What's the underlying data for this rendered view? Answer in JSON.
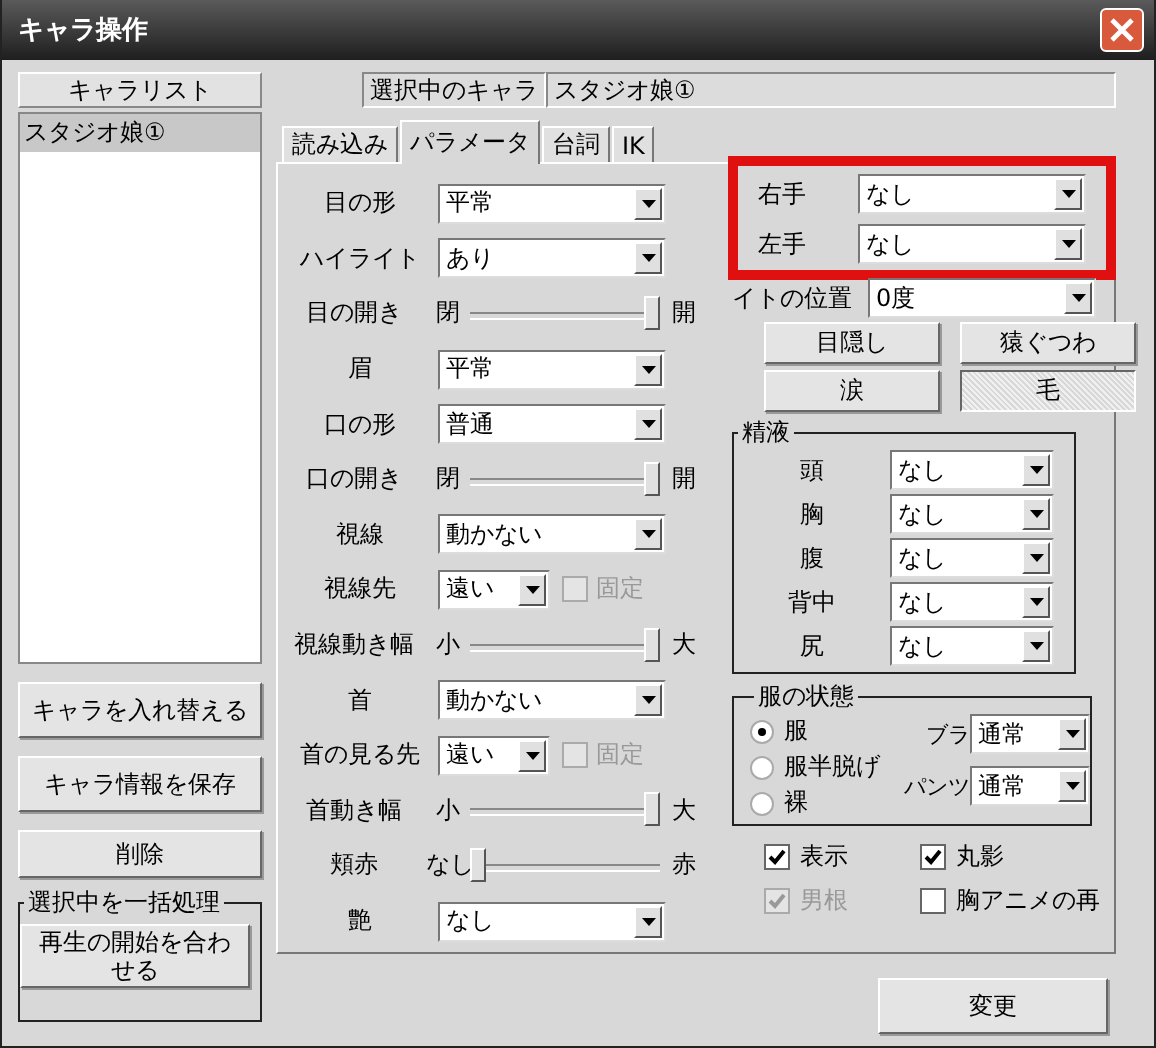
{
  "window": {
    "title": "キャラ操作"
  },
  "char_list": {
    "header": "キャラリスト",
    "items": [
      {
        "label": "スタジオ娘①",
        "selected": true
      }
    ]
  },
  "left_buttons": [
    "キャラを入れ替える",
    "キャラ情報を保存",
    "削除"
  ],
  "batch_group": {
    "title": "選択中を一括処理",
    "button": "再生の開始を合わせる"
  },
  "selected_char": {
    "label": "選択中のキャラ",
    "value": "スタジオ娘①"
  },
  "tabs": [
    {
      "label": "読み込み",
      "selected": false
    },
    {
      "label": "パラメータ",
      "selected": true
    },
    {
      "label": "台詞",
      "selected": false
    },
    {
      "label": "IK",
      "selected": false
    }
  ],
  "params": [
    {
      "kind": "select",
      "label": "目の形",
      "value": "平常"
    },
    {
      "kind": "select",
      "label": "ハイライト",
      "value": "あり"
    },
    {
      "kind": "slider",
      "label": "目の開き",
      "min_label": "閉",
      "max_label": "開",
      "level": 1
    },
    {
      "kind": "select",
      "label": "眉",
      "value": "平常"
    },
    {
      "kind": "select",
      "label": "口の形",
      "value": "普通"
    },
    {
      "kind": "slider",
      "label": "口の開き",
      "min_label": "閉",
      "max_label": "開",
      "level": 1
    },
    {
      "kind": "select",
      "label": "視線",
      "value": "動かない"
    },
    {
      "kind": "select_lock",
      "label": "視線先",
      "value": "遠い",
      "check_label": "固定",
      "checked": false,
      "disabled": true
    },
    {
      "kind": "slider",
      "label": "視線動き幅",
      "min_label": "小",
      "max_label": "大",
      "level": 1
    },
    {
      "kind": "select",
      "label": "首",
      "value": "動かない"
    },
    {
      "kind": "select_lock",
      "label": "首の見る先",
      "value": "遠い",
      "check_label": "固定",
      "checked": false,
      "disabled": true
    },
    {
      "kind": "slider",
      "label": "首動き幅",
      "min_label": "小",
      "max_label": "大",
      "level": 1
    },
    {
      "kind": "slider",
      "label": "頬赤",
      "min_label": "なし",
      "max_label": "赤",
      "level": 0
    },
    {
      "kind": "select",
      "label": "艶",
      "value": "なし"
    }
  ],
  "hands": [
    {
      "label": "右手",
      "value": "なし"
    },
    {
      "label": "左手",
      "value": "なし"
    }
  ],
  "light": {
    "label": "イトの位置",
    "value": "0度"
  },
  "toggle_buttons": [
    {
      "label": "目隠し",
      "pressed": false
    },
    {
      "label": "猿ぐつわ",
      "pressed": false
    },
    {
      "label": "涙",
      "pressed": false
    },
    {
      "label": "毛",
      "pressed": true
    }
  ],
  "fluid_group": {
    "title": "精液",
    "rows": [
      {
        "label": "頭",
        "value": "なし"
      },
      {
        "label": "胸",
        "value": "なし"
      },
      {
        "label": "腹",
        "value": "なし"
      },
      {
        "label": "背中",
        "value": "なし"
      },
      {
        "label": "尻",
        "value": "なし"
      }
    ]
  },
  "clothes_group": {
    "title": "服の状態",
    "options": [
      {
        "label": "服",
        "selected": true
      },
      {
        "label": "服半脱げ",
        "selected": false
      },
      {
        "label": "裸",
        "selected": false
      }
    ],
    "bra": {
      "label": "ブラ",
      "value": "通常"
    },
    "pants": {
      "label": "パンツ",
      "value": "通常"
    }
  },
  "checks": [
    {
      "label": "表示",
      "checked": true,
      "disabled": false
    },
    {
      "label": "丸影",
      "checked": true,
      "disabled": false
    },
    {
      "label": "男根",
      "checked": true,
      "disabled": true
    },
    {
      "label": "胸アニメの再",
      "checked": false,
      "disabled": false
    }
  ],
  "apply_button": "変更"
}
